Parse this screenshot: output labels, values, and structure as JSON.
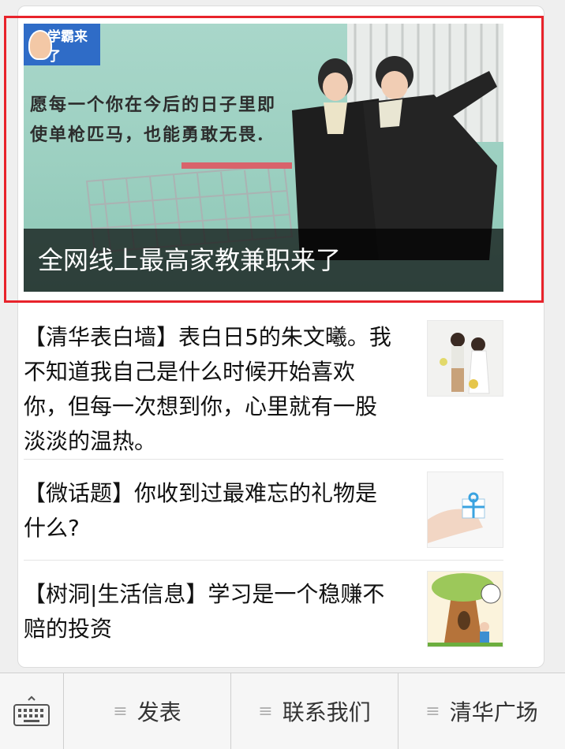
{
  "cover": {
    "logo_text": "学霸来了",
    "slogan_line1": "愿每一个你在今后的日子里即",
    "slogan_line2": "使单枪匹马，也能勇敢无畏.",
    "caption": "全网线上最高家教兼职来了"
  },
  "articles": [
    {
      "title": "【清华表白墙】表白日5的朱文曦。我不知道我自己是什么时候开始喜欢你，但每一次想到你，心里就有一股淡淡的温热。",
      "thumb": "couple-photo"
    },
    {
      "title": "【微话题】你收到过最难忘的礼物是什么?",
      "thumb": "gift-photo"
    },
    {
      "title": "【树洞|生活信息】学习是一个稳赚不赔的投资",
      "thumb": "tree-cartoon"
    }
  ],
  "menu": [
    {
      "label": "发表"
    },
    {
      "label": "联系我们"
    },
    {
      "label": "清华广场"
    }
  ],
  "icons": {
    "keyboard": "keyboard-icon",
    "menu": "menu-lines-icon"
  },
  "colors": {
    "highlight": "#e8232b",
    "caption_bg": "#000000"
  }
}
